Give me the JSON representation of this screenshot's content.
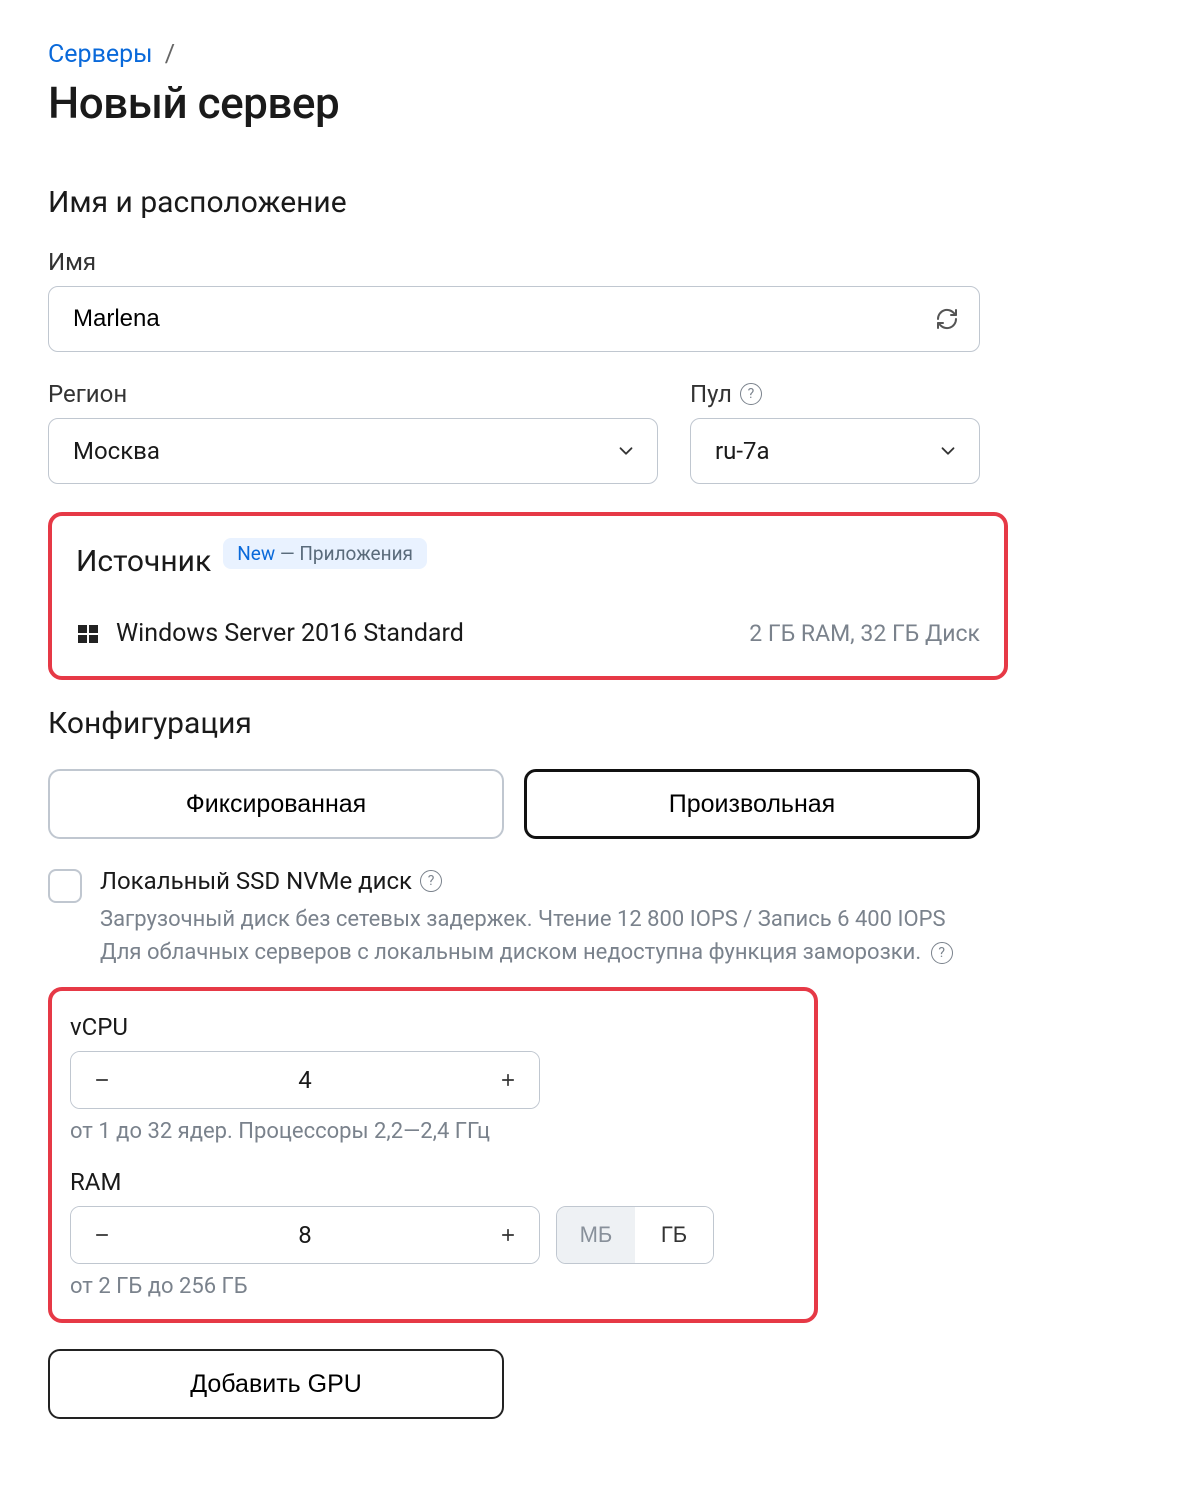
{
  "breadcrumb": {
    "parent": "Серверы",
    "sep": "/"
  },
  "page_title": "Новый сервер",
  "sections": {
    "name_location": {
      "title": "Имя и расположение",
      "name_label": "Имя",
      "name_value": "Marlena",
      "region_label": "Регион",
      "region_value": "Москва",
      "pool_label": "Пул",
      "pool_value": "ru-7a"
    },
    "source": {
      "title": "Источник",
      "badge_new": "New",
      "badge_dash": " — ",
      "badge_apps": "Приложения",
      "os_name": "Windows Server 2016 Standard",
      "os_spec": "2 ГБ RAM, 32 ГБ Диск"
    },
    "config": {
      "title": "Конфигурация",
      "tab_fixed": "Фиксированная",
      "tab_custom": "Произвольная",
      "ssd_title": "Локальный SSD NVMe диск",
      "ssd_desc_line1": "Загрузочный диск без сетевых задержек. Чтение 12 800 IOPS / Запись 6 400 IOPS",
      "ssd_desc_line2_a": "Для облачных серверов с локальным диском недоступна функция заморозки.",
      "vcpu_label": "vCPU",
      "vcpu_value": "4",
      "vcpu_hint": "от 1 до 32 ядер. Процессоры 2,2—2,4 ГГц",
      "ram_label": "RAM",
      "ram_value": "8",
      "ram_unit_mb": "МБ",
      "ram_unit_gb": "ГБ",
      "ram_hint": "от 2 ГБ до 256 ГБ",
      "gpu_button": "Добавить GPU"
    }
  }
}
